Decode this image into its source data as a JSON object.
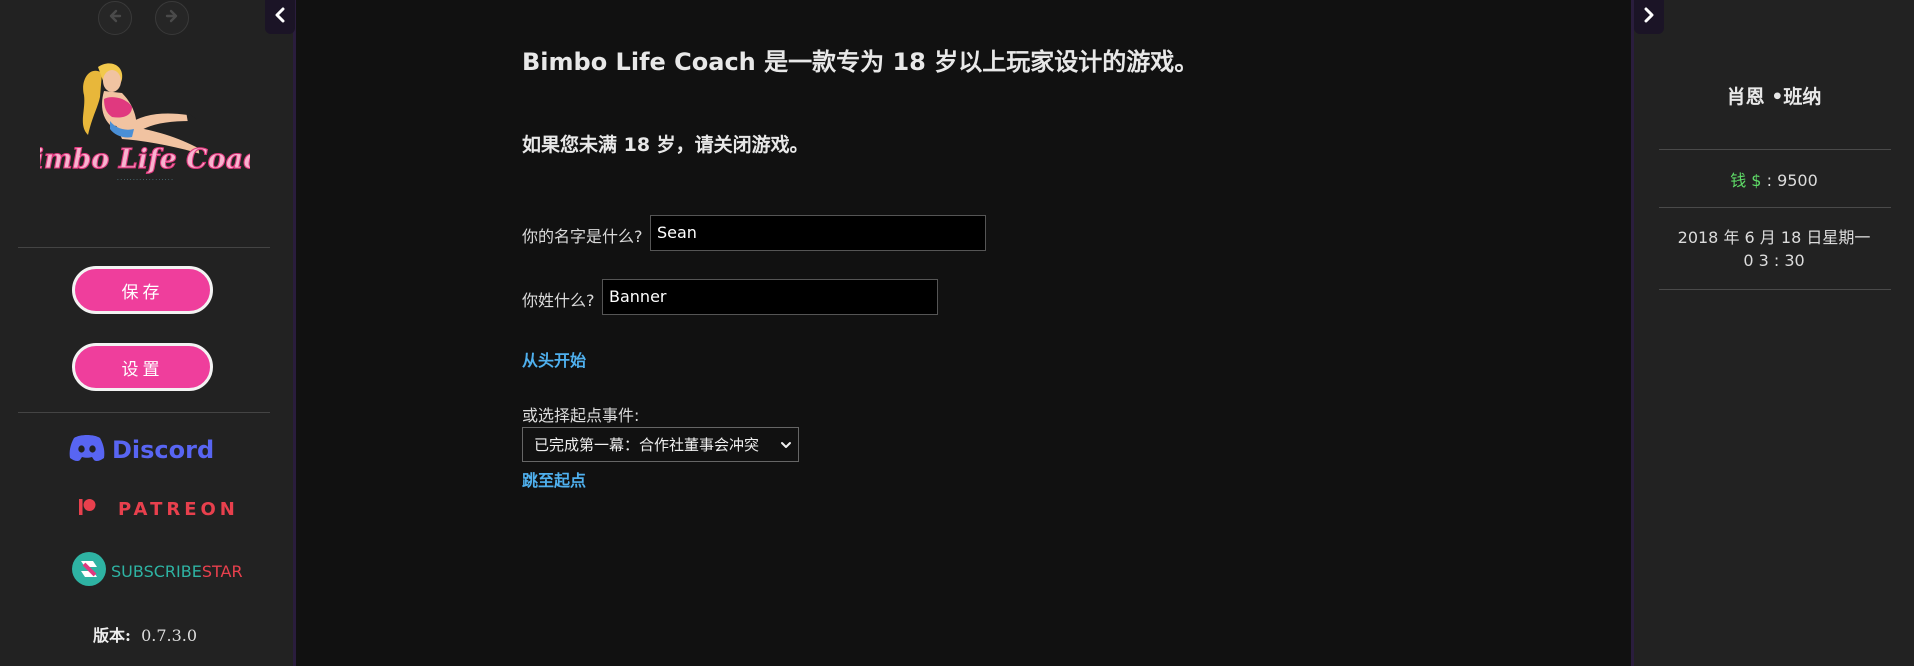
{
  "colors": {
    "accent_pink": "#ef3e9c",
    "link_blue": "#4fb0ee",
    "money_green": "#5fdc68",
    "discord_blue": "#5865f2",
    "patreon_red": "#e8404d",
    "subscribestar_teal": "#2eb3a3"
  },
  "sidebar": {
    "back_icon": "arrow-left-icon",
    "forward_icon": "arrow-right-icon",
    "toggle_icon": "chevron-left-icon",
    "logo_text": "Bimbo Life Coach",
    "save_label": "保存",
    "settings_label": "设置",
    "discord_label": "Discord",
    "patreon_label": "PATREON",
    "subscribestar_label_a": "SUBSCRIBE",
    "subscribestar_label_b": "STAR",
    "version_label": "版本:",
    "version_value": "0.7.3.0"
  },
  "main": {
    "title": "Bimbo Life Coach 是一款专为 18 岁以上玩家设计的游戏。",
    "warning": "如果您未满 18 岁，请关闭游戏。",
    "first_name_label": "你的名字是什么?",
    "first_name_value": "Sean",
    "last_name_label": "你姓什么?",
    "last_name_value": "Banner",
    "start_link": "从头开始",
    "start_event_label": "或选择起点事件:",
    "start_event_selected": "已完成第一幕：合作社董事会冲突",
    "jump_link": "跳至起点"
  },
  "right_sidebar": {
    "toggle_icon": "chevron-right-icon",
    "player_name": "肖恩 •班纳",
    "money_label": "钱 $",
    "money_sep": ":",
    "money_value": "9500",
    "date_line1": "2018 年 6 月 18 日星期一",
    "date_line2": "0 3 : 30"
  }
}
